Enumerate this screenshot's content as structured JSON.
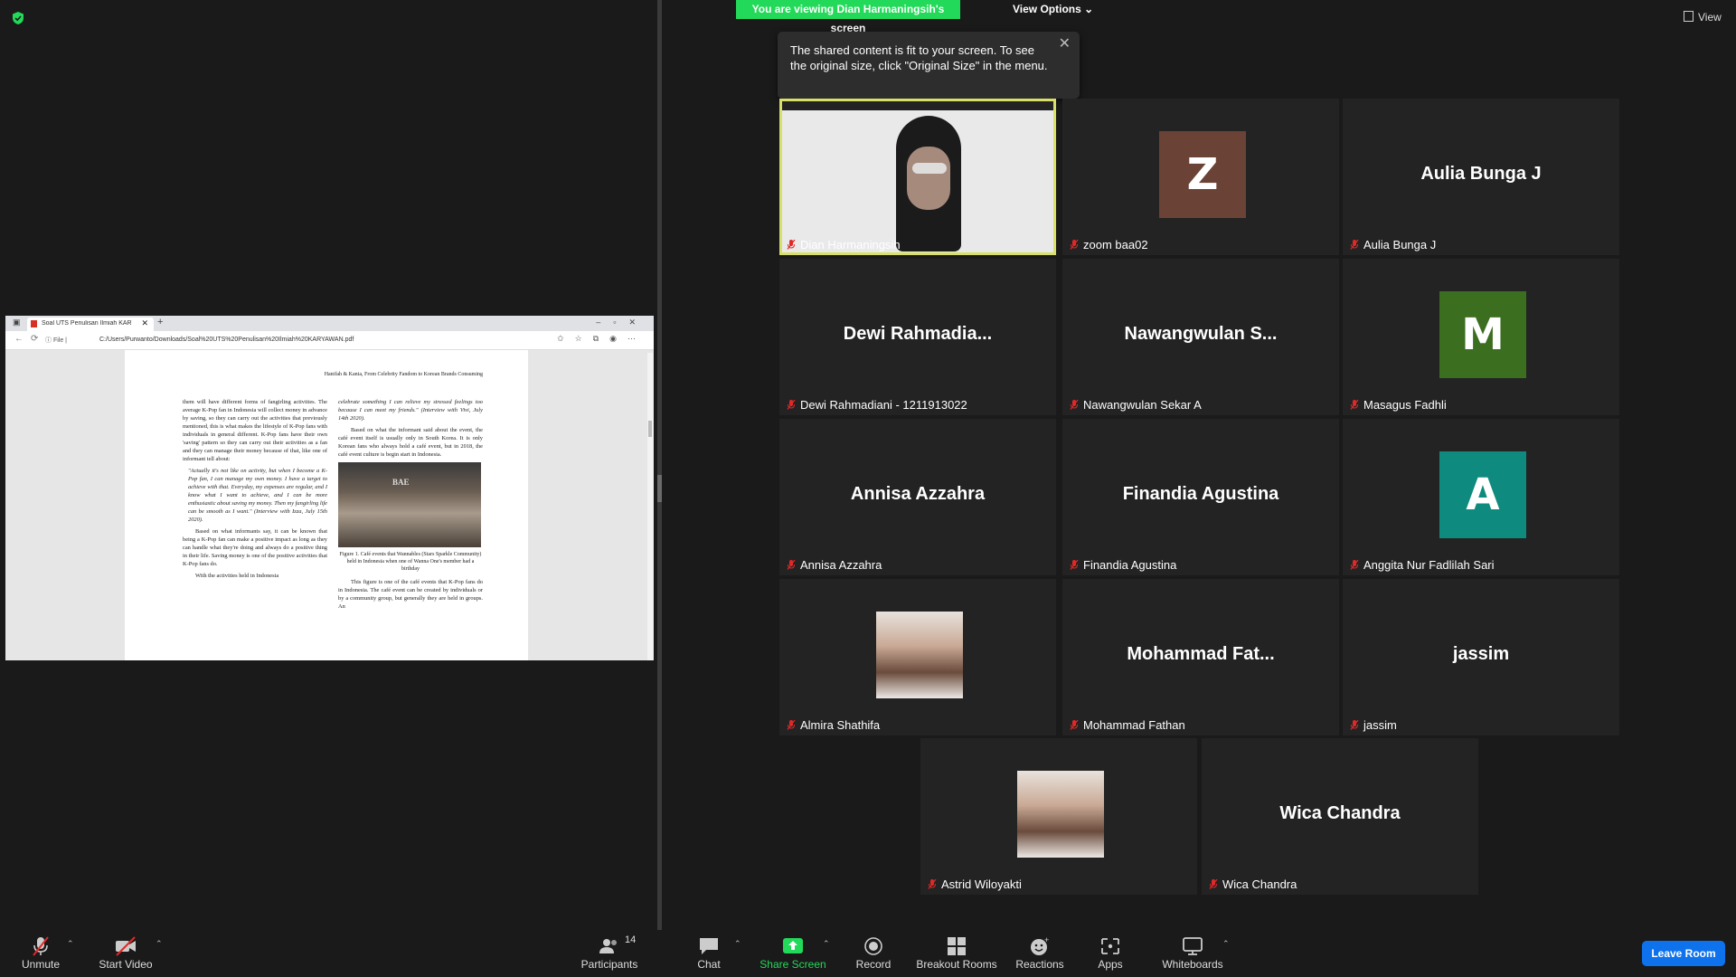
{
  "banner": {
    "text": "You are viewing Dian Harmaningsih's screen",
    "view_options": "View Options",
    "view": "View"
  },
  "tooltip": {
    "text": "The shared content is fit to your screen. To see the original size, click \"Original Size\" in the menu."
  },
  "browser": {
    "tab_title": "Soal UTS Penulisan Ilmiah KARY",
    "file_label": "File",
    "url": "C:/Users/Purwanto/Downloads/Soal%20UTS%20Penulisan%20Ilmiah%20KARYAWAN.pdf"
  },
  "pdf": {
    "running_head": "Hanifah & Kania, From Celebrity Fandom to Korean Brands Consuming",
    "left_col": [
      "them will have different forms of fangirling activities. The average K-Pop fan in Indonesia will collect money in advance by saving, so they can carry out the activities that previously mentioned, this is what makes the lifestyle of K-Pop fans with individuals in general different. K-Pop fans have their own 'saving' pattern so they can carry out their activities as a fan and they can manage their money because of that, like one of informant tell about:",
      "\"Actually it's not like on activity, but when I become a K-Pop fan, I can manage my own money. I have a target to achieve with that. Everyday, my expenses are regular, and I know what I want to achieve, and I can be more enthusiastic about saving my money. Then my fangirling life can be smooth as I want.\" (Interview with Izza, July 15th 2020).",
      "Based on what informants say, it can be known that being a K-Pop fan can make a positive impact as long as they can handle what they're doing and always do a positive thing in their life. Saving money is one of the positive activities that K-Pop fans do.",
      "With the activities held in Indonesia"
    ],
    "right_col": [
      "celebrate something I can relieve my stressed feelings too because I can meet my friends.\" (Interview with Vivi, July 14th 2020).",
      "Based on what the informant said about the event, the café event itself is usually only in South Korea. It is only Korean fans who always hold a café event, but in 2018, the café event culture is begin start in Indonesia."
    ],
    "figure_sign": "BAE",
    "figure_caption": "Figure 1. Café events that Wannables (Stars Sparkle Community) held in Indonesia when one of Wanna One's member had a birthday",
    "right_col_after": "This figure is one of the café events that K-Pop fans do in Indonesia. The café event can be created by individuals or by a community group, but generally they are held in groups. An"
  },
  "participants": [
    {
      "tile": "",
      "label": "Dian Harmaningsih",
      "type": "video"
    },
    {
      "tile": "Z",
      "label": "zoom baa02",
      "type": "avatar",
      "color": "#6b4236"
    },
    {
      "tile": "Aulia Bunga J",
      "label": "Aulia Bunga J",
      "type": "name"
    },
    {
      "tile": "Dewi  Rahmadia...",
      "label": "Dewi Rahmadiani - 1211913022",
      "type": "name"
    },
    {
      "tile": "Nawangwulan  S...",
      "label": "Nawangwulan Sekar A",
      "type": "name"
    },
    {
      "tile": "M",
      "label": "Masagus Fadhli",
      "type": "avatar",
      "color": "#3b6e1f"
    },
    {
      "tile": "Annisa Azzahra",
      "label": "Annisa Azzahra",
      "type": "name"
    },
    {
      "tile": "Finandia Agustina",
      "label": "Finandia Agustina",
      "type": "name"
    },
    {
      "tile": "A",
      "label": "Anggita Nur Fadlilah Sari",
      "type": "avatar",
      "color": "#0f8a7e"
    },
    {
      "tile": "",
      "label": "Almira Shathifa",
      "type": "photo"
    },
    {
      "tile": "Mohammad  Fat...",
      "label": "Mohammad Fathan",
      "type": "name"
    },
    {
      "tile": "jassim",
      "label": "jassim",
      "type": "name"
    },
    {
      "tile": "",
      "label": "Astrid Wiloyakti",
      "type": "photo"
    },
    {
      "tile": "Wica Chandra",
      "label": "Wica Chandra",
      "type": "name"
    }
  ],
  "toolbar": {
    "unmute": "Unmute",
    "start_video": "Start Video",
    "participants": "Participants",
    "participants_count": "14",
    "chat": "Chat",
    "share_screen": "Share Screen",
    "record": "Record",
    "breakout": "Breakout Rooms",
    "reactions": "Reactions",
    "apps": "Apps",
    "whiteboards": "Whiteboards",
    "leave": "Leave Room"
  },
  "colors": {
    "accent_green": "#23d959",
    "leave_blue": "#0e72ed",
    "active_speaker": "#d8e06a",
    "muted_red": "#e02828"
  }
}
